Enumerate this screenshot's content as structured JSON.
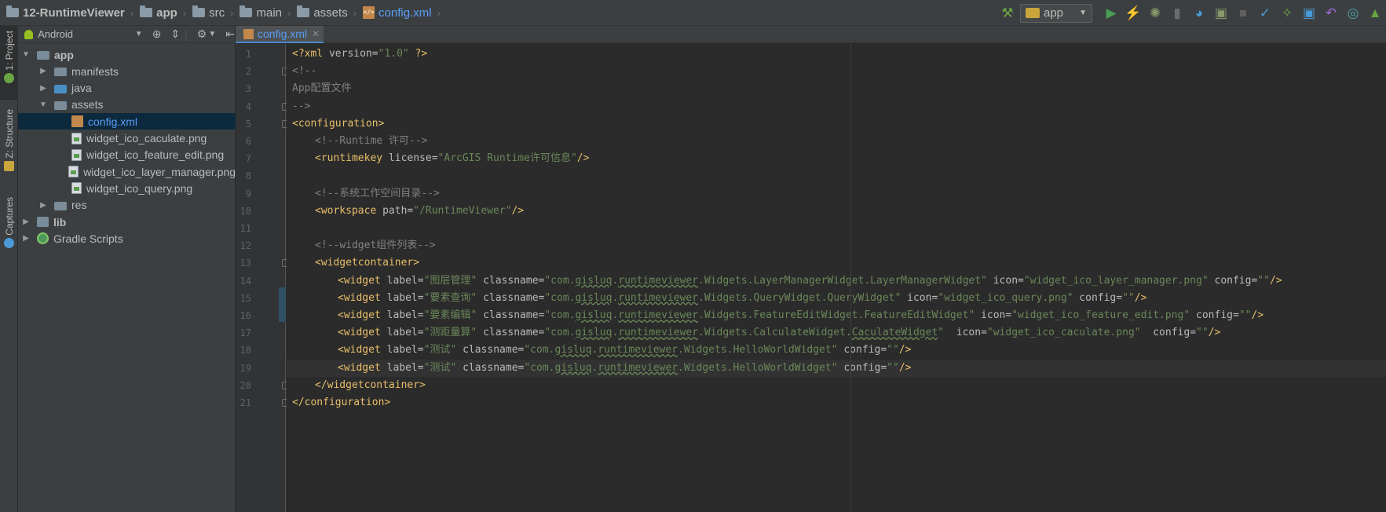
{
  "breadcrumb": [
    {
      "label": "12-RuntimeViewer",
      "icon": "project-folder-icon",
      "bold": true
    },
    {
      "label": "app",
      "icon": "module-folder-icon",
      "bold": true
    },
    {
      "label": "src",
      "icon": "folder-icon"
    },
    {
      "label": "main",
      "icon": "folder-icon"
    },
    {
      "label": "assets",
      "icon": "assets-folder-icon"
    },
    {
      "label": "config.xml",
      "icon": "xml-file-icon",
      "active": true
    }
  ],
  "toolbar": {
    "run_config": "app",
    "icons": [
      "make-project-icon",
      "run-icon",
      "apply-changes-icon",
      "debug-icon",
      "attach-debugger-icon",
      "profile-icon",
      "run-with-coverage-icon",
      "stop-icon",
      "vcs-update-icon",
      "vcs-commit-icon",
      "vcs-history-icon",
      "revert-icon",
      "android-icon"
    ]
  },
  "side_tabs": {
    "project": "1: Project",
    "structure": "Z: Structure",
    "captures": "Captures"
  },
  "project_panel": {
    "view_mode": "Android",
    "tree": [
      {
        "label": "app",
        "depth": 0,
        "expanded": true,
        "type": "module",
        "bold": true
      },
      {
        "label": "manifests",
        "depth": 1,
        "expanded": false,
        "type": "folder"
      },
      {
        "label": "java",
        "depth": 1,
        "expanded": false,
        "type": "folder-blue"
      },
      {
        "label": "assets",
        "depth": 1,
        "expanded": true,
        "type": "assets"
      },
      {
        "label": "config.xml",
        "depth": 2,
        "type": "xml",
        "selected": true
      },
      {
        "label": "widget_ico_caculate.png",
        "depth": 2,
        "type": "png"
      },
      {
        "label": "widget_ico_feature_edit.png",
        "depth": 2,
        "type": "png"
      },
      {
        "label": "widget_ico_layer_manager.png",
        "depth": 2,
        "type": "png"
      },
      {
        "label": "widget_ico_query.png",
        "depth": 2,
        "type": "png"
      },
      {
        "label": "res",
        "depth": 1,
        "expanded": false,
        "type": "folder"
      },
      {
        "label": "lib",
        "depth": 0,
        "expanded": false,
        "type": "lib",
        "bold": true
      },
      {
        "label": "Gradle Scripts",
        "depth": 0,
        "expanded": false,
        "type": "gradle"
      }
    ]
  },
  "editor": {
    "tab_label": "config.xml",
    "line_numbers": [
      "1",
      "2",
      "3",
      "4",
      "5",
      "6",
      "7",
      "8",
      "9",
      "10",
      "11",
      "12",
      "13",
      "14",
      "15",
      "16",
      "17",
      "18",
      "19",
      "20",
      "21"
    ],
    "lines": [
      {
        "indent": 0,
        "parts": [
          [
            "tag",
            "<?xml "
          ],
          [
            "attr",
            "version="
          ],
          [
            "val",
            "\"1.0\""
          ],
          [
            "tag",
            " ?>"
          ]
        ]
      },
      {
        "indent": 0,
        "parts": [
          [
            "com",
            "<!--"
          ]
        ]
      },
      {
        "indent": 0,
        "parts": [
          [
            "com",
            "App配置文件"
          ]
        ]
      },
      {
        "indent": 0,
        "parts": [
          [
            "com",
            "-->"
          ]
        ]
      },
      {
        "indent": 0,
        "parts": [
          [
            "tag",
            "<configuration>"
          ]
        ]
      },
      {
        "indent": 1,
        "parts": [
          [
            "com",
            "<!--Runtime 许可-->"
          ]
        ]
      },
      {
        "indent": 1,
        "parts": [
          [
            "tag",
            "<runtimekey "
          ],
          [
            "attr",
            "license="
          ],
          [
            "val",
            "\"ArcGIS Runtime许可信息\""
          ],
          [
            "tag",
            "/>"
          ]
        ]
      },
      {
        "indent": 0,
        "parts": []
      },
      {
        "indent": 1,
        "parts": [
          [
            "com",
            "<!--系统工作空间目录-->"
          ]
        ]
      },
      {
        "indent": 1,
        "parts": [
          [
            "tag",
            "<workspace "
          ],
          [
            "attr",
            "path="
          ],
          [
            "val",
            "\"/RuntimeViewer\""
          ],
          [
            "tag",
            "/>"
          ]
        ]
      },
      {
        "indent": 0,
        "parts": []
      },
      {
        "indent": 1,
        "parts": [
          [
            "com",
            "<!--widget组件列表-->"
          ]
        ]
      },
      {
        "indent": 1,
        "parts": [
          [
            "tag",
            "<widgetcontainer>"
          ]
        ]
      },
      {
        "indent": 2,
        "parts": [
          [
            "tag",
            "<widget "
          ],
          [
            "attr",
            "label="
          ],
          [
            "val",
            "\"图层管理\""
          ],
          [
            "attr",
            " classname="
          ],
          [
            "val",
            "\"com."
          ],
          [
            "valu",
            "gisluq"
          ],
          [
            "val",
            "."
          ],
          [
            "valu",
            "runtimeviewer"
          ],
          [
            "val",
            ".Widgets.LayerManagerWidget.LayerManagerWidget\""
          ],
          [
            "attr",
            " icon="
          ],
          [
            "val",
            "\"widget_ico_layer_manager.png\""
          ],
          [
            "attr",
            " config="
          ],
          [
            "val",
            "\"\""
          ],
          [
            "tag",
            "/>"
          ]
        ]
      },
      {
        "indent": 2,
        "parts": [
          [
            "tag",
            "<widget "
          ],
          [
            "attr",
            "label="
          ],
          [
            "val",
            "\"要素查询\""
          ],
          [
            "attr",
            " classname="
          ],
          [
            "val",
            "\"com."
          ],
          [
            "valu",
            "gisluq"
          ],
          [
            "val",
            "."
          ],
          [
            "valu",
            "runtimeviewer"
          ],
          [
            "val",
            ".Widgets.QueryWidget.QueryWidget\""
          ],
          [
            "attr",
            " icon="
          ],
          [
            "val",
            "\"widget_ico_query.png\""
          ],
          [
            "attr",
            " config="
          ],
          [
            "val",
            "\"\""
          ],
          [
            "tag",
            "/>"
          ]
        ]
      },
      {
        "indent": 2,
        "parts": [
          [
            "tag",
            "<widget "
          ],
          [
            "attr",
            "label="
          ],
          [
            "val",
            "\"要素编辑\""
          ],
          [
            "attr",
            " classname="
          ],
          [
            "val",
            "\"com."
          ],
          [
            "valu",
            "gisluq"
          ],
          [
            "val",
            "."
          ],
          [
            "valu",
            "runtimeviewer"
          ],
          [
            "val",
            ".Widgets.FeatureEditWidget.FeatureEditWidget\""
          ],
          [
            "attr",
            " icon="
          ],
          [
            "val",
            "\"widget_ico_feature_edit.png\""
          ],
          [
            "attr",
            " config="
          ],
          [
            "val",
            "\"\""
          ],
          [
            "tag",
            "/>"
          ]
        ]
      },
      {
        "indent": 2,
        "parts": [
          [
            "tag",
            "<widget "
          ],
          [
            "attr",
            "label="
          ],
          [
            "val",
            "\"测距量算\""
          ],
          [
            "attr",
            " classname="
          ],
          [
            "val",
            "\"com."
          ],
          [
            "valu",
            "gisluq"
          ],
          [
            "val",
            "."
          ],
          [
            "valu",
            "runtimeviewer"
          ],
          [
            "val",
            ".Widgets.CalculateWidget."
          ],
          [
            "valu",
            "CaculateWidget"
          ],
          [
            "val",
            "\""
          ],
          [
            "attr",
            "  icon="
          ],
          [
            "val",
            "\"widget_ico_caculate.png\""
          ],
          [
            "attr",
            "  config="
          ],
          [
            "val",
            "\"\""
          ],
          [
            "tag",
            "/>"
          ]
        ]
      },
      {
        "indent": 2,
        "parts": [
          [
            "tag",
            "<widget "
          ],
          [
            "attr",
            "label="
          ],
          [
            "val",
            "\"测试\""
          ],
          [
            "attr",
            " classname="
          ],
          [
            "val",
            "\"com."
          ],
          [
            "valu",
            "gisluq"
          ],
          [
            "val",
            "."
          ],
          [
            "valu",
            "runtimeviewer"
          ],
          [
            "val",
            ".Widgets.HelloWorldWidget\""
          ],
          [
            "attr",
            " config="
          ],
          [
            "val",
            "\"\""
          ],
          [
            "tag",
            "/>"
          ]
        ]
      },
      {
        "indent": 2,
        "parts": [
          [
            "tag",
            "<widget "
          ],
          [
            "attr",
            "label="
          ],
          [
            "val",
            "\"测试\""
          ],
          [
            "attr",
            " classname="
          ],
          [
            "val",
            "\"com."
          ],
          [
            "valu",
            "gisluq"
          ],
          [
            "val",
            "."
          ],
          [
            "valu",
            "runtimeviewer"
          ],
          [
            "val",
            ".Widgets.HelloWorldWidget\""
          ],
          [
            "attr",
            " config="
          ],
          [
            "val",
            "\"\""
          ],
          [
            "tag",
            "/>"
          ]
        ]
      },
      {
        "indent": 1,
        "parts": [
          [
            "tag",
            "</widgetcontainer>"
          ]
        ]
      },
      {
        "indent": 0,
        "parts": [
          [
            "tag",
            "</configuration>"
          ]
        ]
      }
    ]
  }
}
